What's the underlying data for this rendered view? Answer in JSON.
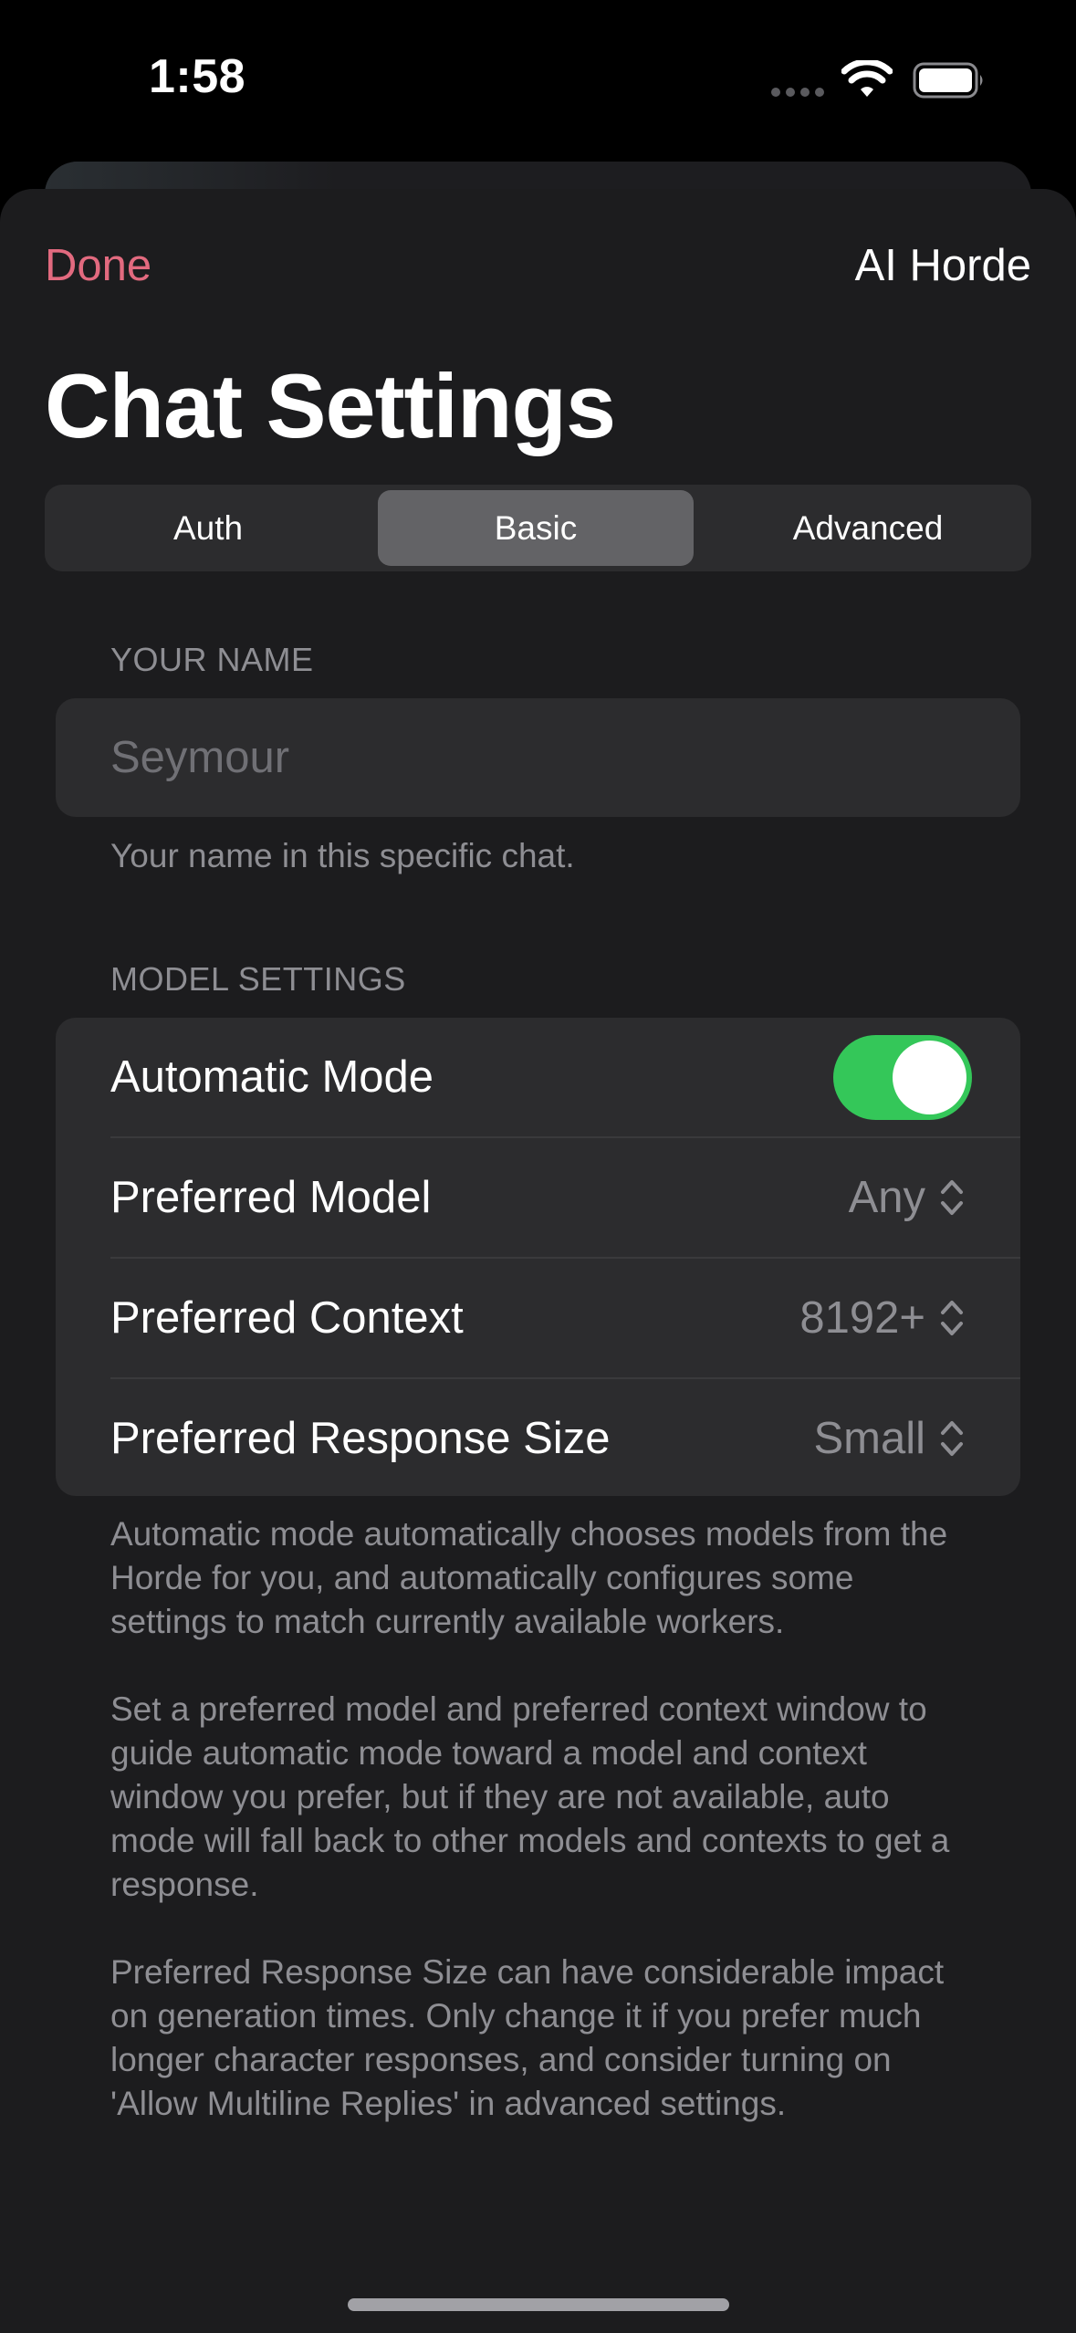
{
  "status_bar": {
    "time": "1:58"
  },
  "nav": {
    "done_label": "Done",
    "provider_label": "AI Horde"
  },
  "page_title": "Chat Settings",
  "tabs": [
    {
      "label": "Auth",
      "selected": false
    },
    {
      "label": "Basic",
      "selected": true
    },
    {
      "label": "Advanced",
      "selected": false
    }
  ],
  "your_name": {
    "header": "YOUR NAME",
    "placeholder": "Seymour",
    "value": "",
    "footer": "Your name in this specific chat."
  },
  "model_settings": {
    "header": "MODEL SETTINGS",
    "automatic_mode": {
      "label": "Automatic Mode",
      "enabled": true
    },
    "preferred_model": {
      "label": "Preferred Model",
      "value": "Any"
    },
    "preferred_context": {
      "label": "Preferred Context",
      "value": "8192+"
    },
    "preferred_response_size": {
      "label": "Preferred Response Size",
      "value": "Small"
    },
    "footer_paragraphs": [
      "Automatic mode automatically chooses models from the Horde for you, and automatically configures some settings to match currently available workers.",
      "Set a preferred model and preferred context window to guide automatic mode toward a model and context window you prefer, but if they are not available, auto mode will fall back to other models and contexts to get a response.",
      "Preferred Response Size can have considerable impact on generation times. Only change it if you prefer much longer character responses, and consider turning on 'Allow Multiline Replies' in advanced settings."
    ]
  },
  "colors": {
    "accent_done": "#e26a7f",
    "toggle_on": "#34c759",
    "background": "#1c1c1e",
    "cell": "#2c2c2e",
    "secondary_text": "#8e8e93"
  },
  "icons": [
    "cellular-signal-icon",
    "wifi-icon",
    "battery-icon",
    "up-down-chevron-icon"
  ]
}
